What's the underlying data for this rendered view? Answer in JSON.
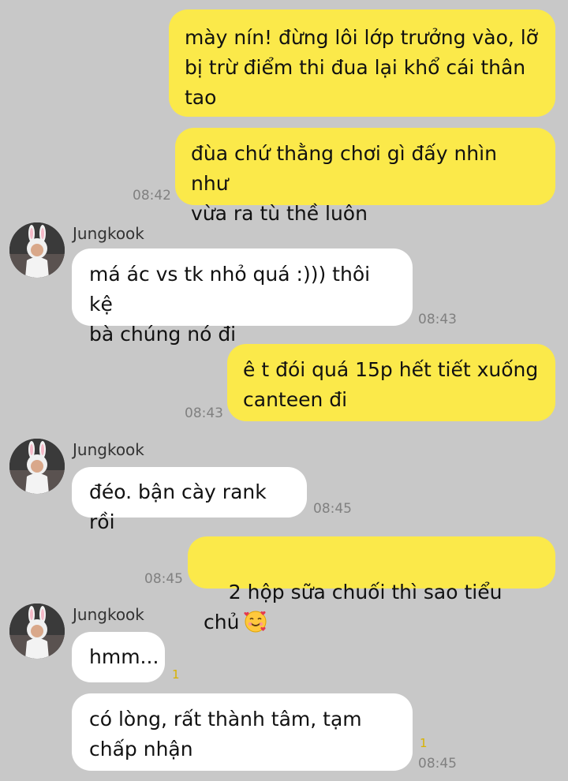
{
  "messages": [
    {
      "id": "m1",
      "side": "out",
      "text": "mày nín! đừng lôi lớp trưởng vào, lỡ\nbị trừ điểm thi đua lại khổ cái thân\ntao"
    },
    {
      "id": "m2",
      "side": "out",
      "text": "đùa chứ thằng chơi gì đấy nhìn như\nvừa ra tù thề luôn",
      "time": "08:42"
    },
    {
      "id": "m3",
      "side": "in",
      "sender": "Jungkook",
      "text": "má ác vs tk nhỏ quá :))) thôi kệ\nbà chúng nó đi",
      "time": "08:43"
    },
    {
      "id": "m4",
      "side": "out",
      "text": "ê t đói quá 15p hết tiết xuống\ncanteen đi",
      "time": "08:43"
    },
    {
      "id": "m5",
      "side": "in",
      "sender": "Jungkook",
      "text": "đéo. bận cày rank rồi",
      "time": "08:45"
    },
    {
      "id": "m6",
      "side": "out",
      "text": "2 hộp sữa chuối thì sao tiểu chủ",
      "emoji": "smiling-face-with-hearts",
      "time": "08:45"
    },
    {
      "id": "m7",
      "side": "in",
      "sender": "Jungkook",
      "text": "hmm...",
      "unread": "1"
    },
    {
      "id": "m8",
      "side": "in",
      "text": "có lòng, rất thành tâm, tạm\nchấp nhận",
      "unread": "1",
      "time": "08:45"
    }
  ],
  "colors": {
    "background": "#c8c8c8",
    "outgoing_bubble": "#fbe94a",
    "incoming_bubble": "#ffffff",
    "timestamp": "#808080",
    "unread_count": "#d9b200"
  }
}
